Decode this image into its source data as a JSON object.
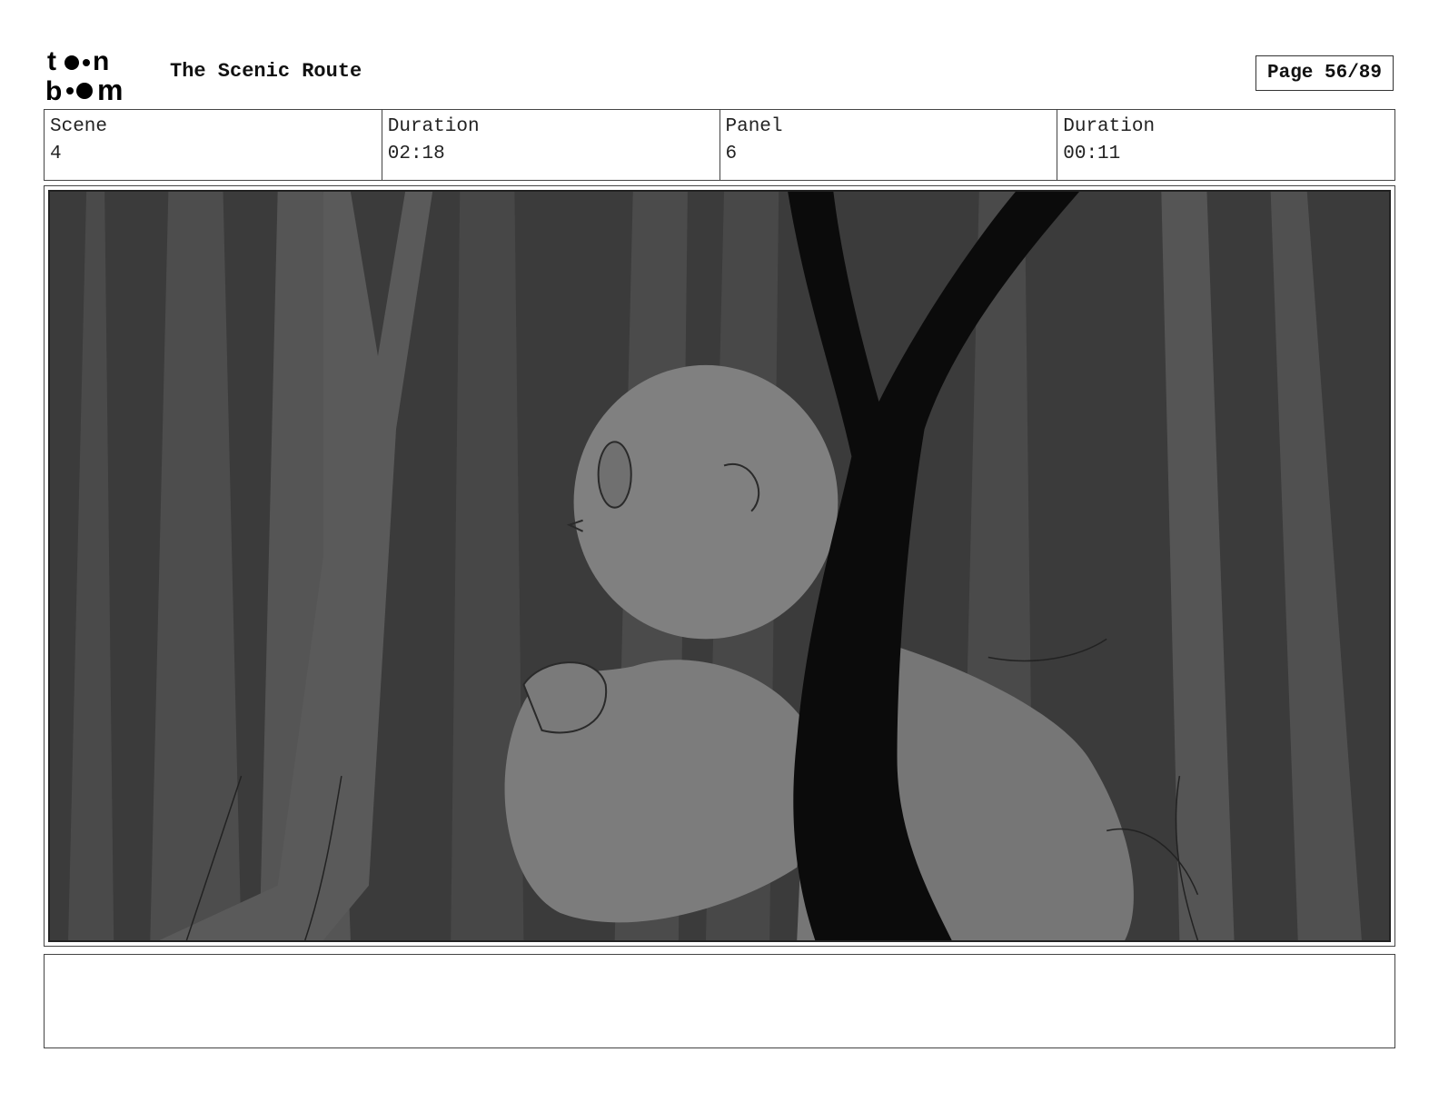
{
  "header": {
    "logo_text": "toon boom",
    "project_title": "The Scenic Route",
    "page_label": "Page 56/89"
  },
  "info": [
    {
      "label": "Scene",
      "value": "4"
    },
    {
      "label": "Duration",
      "value": "02:18"
    },
    {
      "label": "Panel",
      "value": "6"
    },
    {
      "label": "Duration",
      "value": "00:11"
    }
  ],
  "notes": ""
}
